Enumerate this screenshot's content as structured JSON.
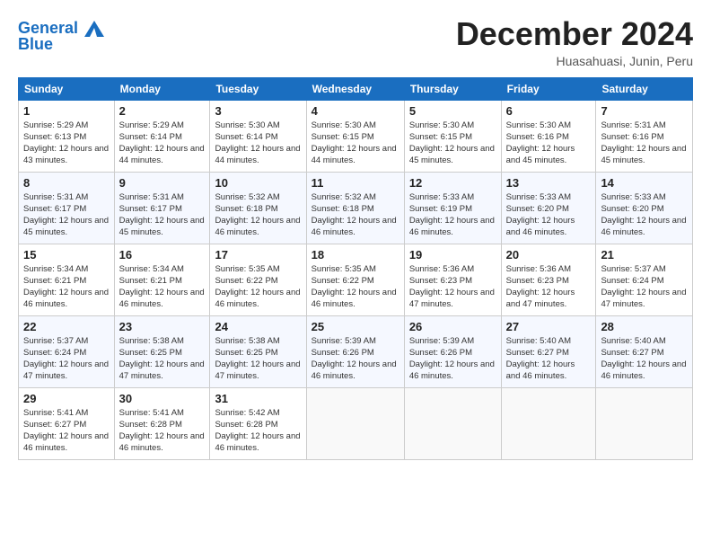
{
  "header": {
    "logo_line1": "General",
    "logo_line2": "Blue",
    "month": "December 2024",
    "location": "Huasahuasi, Junin, Peru"
  },
  "weekdays": [
    "Sunday",
    "Monday",
    "Tuesday",
    "Wednesday",
    "Thursday",
    "Friday",
    "Saturday"
  ],
  "weeks": [
    [
      {
        "day": "1",
        "sunrise": "5:29 AM",
        "sunset": "6:13 PM",
        "daylight": "12 hours and 43 minutes."
      },
      {
        "day": "2",
        "sunrise": "5:29 AM",
        "sunset": "6:14 PM",
        "daylight": "12 hours and 44 minutes."
      },
      {
        "day": "3",
        "sunrise": "5:30 AM",
        "sunset": "6:14 PM",
        "daylight": "12 hours and 44 minutes."
      },
      {
        "day": "4",
        "sunrise": "5:30 AM",
        "sunset": "6:15 PM",
        "daylight": "12 hours and 44 minutes."
      },
      {
        "day": "5",
        "sunrise": "5:30 AM",
        "sunset": "6:15 PM",
        "daylight": "12 hours and 45 minutes."
      },
      {
        "day": "6",
        "sunrise": "5:30 AM",
        "sunset": "6:16 PM",
        "daylight": "12 hours and 45 minutes."
      },
      {
        "day": "7",
        "sunrise": "5:31 AM",
        "sunset": "6:16 PM",
        "daylight": "12 hours and 45 minutes."
      }
    ],
    [
      {
        "day": "8",
        "sunrise": "5:31 AM",
        "sunset": "6:17 PM",
        "daylight": "12 hours and 45 minutes."
      },
      {
        "day": "9",
        "sunrise": "5:31 AM",
        "sunset": "6:17 PM",
        "daylight": "12 hours and 45 minutes."
      },
      {
        "day": "10",
        "sunrise": "5:32 AM",
        "sunset": "6:18 PM",
        "daylight": "12 hours and 46 minutes."
      },
      {
        "day": "11",
        "sunrise": "5:32 AM",
        "sunset": "6:18 PM",
        "daylight": "12 hours and 46 minutes."
      },
      {
        "day": "12",
        "sunrise": "5:33 AM",
        "sunset": "6:19 PM",
        "daylight": "12 hours and 46 minutes."
      },
      {
        "day": "13",
        "sunrise": "5:33 AM",
        "sunset": "6:20 PM",
        "daylight": "12 hours and 46 minutes."
      },
      {
        "day": "14",
        "sunrise": "5:33 AM",
        "sunset": "6:20 PM",
        "daylight": "12 hours and 46 minutes."
      }
    ],
    [
      {
        "day": "15",
        "sunrise": "5:34 AM",
        "sunset": "6:21 PM",
        "daylight": "12 hours and 46 minutes."
      },
      {
        "day": "16",
        "sunrise": "5:34 AM",
        "sunset": "6:21 PM",
        "daylight": "12 hours and 46 minutes."
      },
      {
        "day": "17",
        "sunrise": "5:35 AM",
        "sunset": "6:22 PM",
        "daylight": "12 hours and 46 minutes."
      },
      {
        "day": "18",
        "sunrise": "5:35 AM",
        "sunset": "6:22 PM",
        "daylight": "12 hours and 46 minutes."
      },
      {
        "day": "19",
        "sunrise": "5:36 AM",
        "sunset": "6:23 PM",
        "daylight": "12 hours and 47 minutes."
      },
      {
        "day": "20",
        "sunrise": "5:36 AM",
        "sunset": "6:23 PM",
        "daylight": "12 hours and 47 minutes."
      },
      {
        "day": "21",
        "sunrise": "5:37 AM",
        "sunset": "6:24 PM",
        "daylight": "12 hours and 47 minutes."
      }
    ],
    [
      {
        "day": "22",
        "sunrise": "5:37 AM",
        "sunset": "6:24 PM",
        "daylight": "12 hours and 47 minutes."
      },
      {
        "day": "23",
        "sunrise": "5:38 AM",
        "sunset": "6:25 PM",
        "daylight": "12 hours and 47 minutes."
      },
      {
        "day": "24",
        "sunrise": "5:38 AM",
        "sunset": "6:25 PM",
        "daylight": "12 hours and 47 minutes."
      },
      {
        "day": "25",
        "sunrise": "5:39 AM",
        "sunset": "6:26 PM",
        "daylight": "12 hours and 46 minutes."
      },
      {
        "day": "26",
        "sunrise": "5:39 AM",
        "sunset": "6:26 PM",
        "daylight": "12 hours and 46 minutes."
      },
      {
        "day": "27",
        "sunrise": "5:40 AM",
        "sunset": "6:27 PM",
        "daylight": "12 hours and 46 minutes."
      },
      {
        "day": "28",
        "sunrise": "5:40 AM",
        "sunset": "6:27 PM",
        "daylight": "12 hours and 46 minutes."
      }
    ],
    [
      {
        "day": "29",
        "sunrise": "5:41 AM",
        "sunset": "6:27 PM",
        "daylight": "12 hours and 46 minutes."
      },
      {
        "day": "30",
        "sunrise": "5:41 AM",
        "sunset": "6:28 PM",
        "daylight": "12 hours and 46 minutes."
      },
      {
        "day": "31",
        "sunrise": "5:42 AM",
        "sunset": "6:28 PM",
        "daylight": "12 hours and 46 minutes."
      },
      null,
      null,
      null,
      null
    ]
  ],
  "labels": {
    "sunrise": "Sunrise:",
    "sunset": "Sunset:",
    "daylight": "Daylight:"
  }
}
